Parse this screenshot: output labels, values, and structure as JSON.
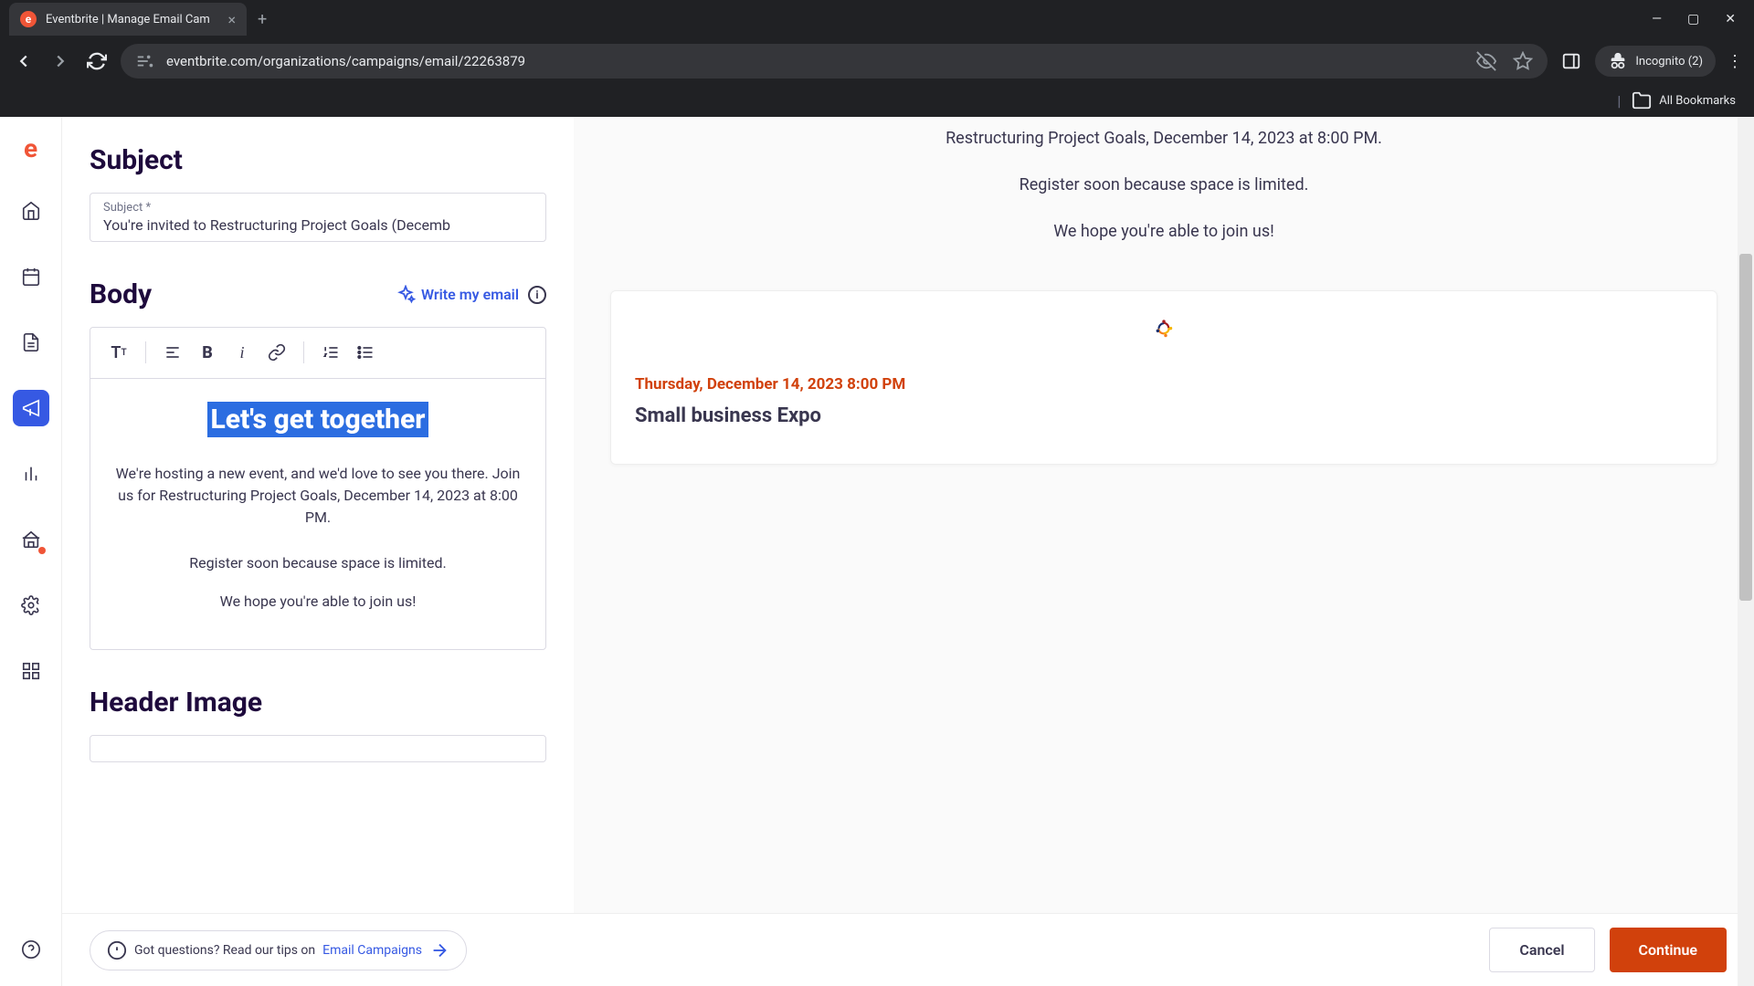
{
  "browser": {
    "tab_title": "Eventbrite | Manage Email Cam",
    "url_display": "eventbrite.com/organizations/campaigns/email/22263879",
    "incognito_label": "Incognito (2)",
    "all_bookmarks": "All Bookmarks"
  },
  "editor": {
    "subject_section": "Subject",
    "subject_label": "Subject *",
    "subject_value": "You're invited to Restructuring Project Goals (Decemb",
    "body_section": "Body",
    "write_email": "Write my email",
    "headline": "Let's get together",
    "para1": "We're hosting a new event, and we'd love to see you there. Join us for Restructuring Project Goals, December 14, 2023 at 8:00 PM.",
    "para2": "Register soon because space is limited.",
    "para3": "We hope you're able to join us!",
    "header_image_section": "Header Image"
  },
  "preview": {
    "line1": "Restructuring Project Goals, December 14, 2023 at 8:00 PM.",
    "line2": "Register soon because space is limited.",
    "line3": "We hope you're able to join us!",
    "event_date": "Thursday, December 14, 2023 8:00 PM",
    "event_name": "Small business Expo"
  },
  "footer": {
    "help_prefix": "Got questions? Read our tips on ",
    "help_link": "Email Campaigns",
    "cancel": "Cancel",
    "continue": "Continue"
  }
}
